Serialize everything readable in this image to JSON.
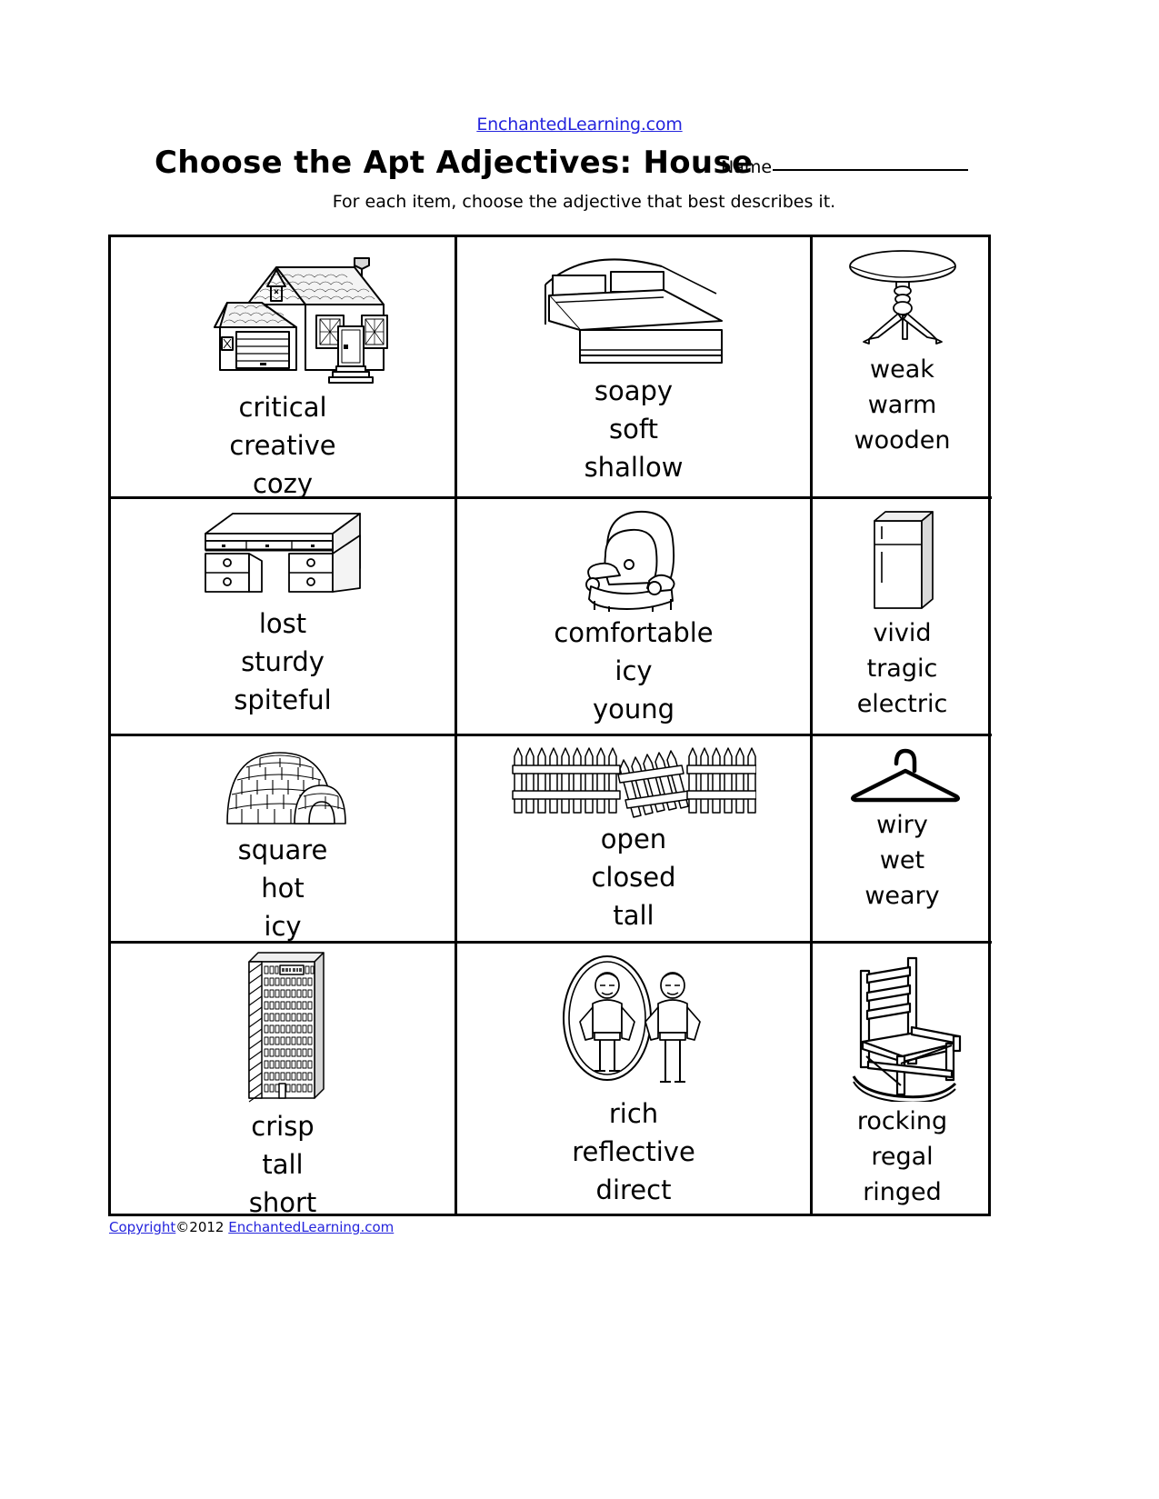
{
  "header": {
    "site_link": "EnchantedLearning.com",
    "title": "Choose the Apt Adjectives: House",
    "subtitle": "For each item, choose the adjective that best describes it.",
    "name_label": "Name"
  },
  "footer": {
    "copyright_link": "Copyright",
    "copyright_text": "©2012 ",
    "site_link": "EnchantedLearning.com"
  },
  "colors": {
    "link": "#2424dd",
    "ink": "#000000",
    "paper": "#ffffff"
  },
  "grid": {
    "columns": 3,
    "rows": 4,
    "cells": [
      {
        "icon": "house-icon",
        "subject": "house",
        "choices": [
          "critical",
          "creative",
          "cozy"
        ]
      },
      {
        "icon": "bed-icon",
        "subject": "bed",
        "choices": [
          "soapy",
          "soft",
          "shallow"
        ]
      },
      {
        "icon": "table-icon",
        "subject": "table",
        "choices": [
          "weak",
          "warm",
          "wooden"
        ]
      },
      {
        "icon": "desk-icon",
        "subject": "desk",
        "choices": [
          "lost",
          "sturdy",
          "spiteful"
        ]
      },
      {
        "icon": "armchair-icon",
        "subject": "armchair",
        "choices": [
          "comfortable",
          "icy",
          "young"
        ]
      },
      {
        "icon": "refrigerator-icon",
        "subject": "refrigerator",
        "choices": [
          "vivid",
          "tragic",
          "electric"
        ]
      },
      {
        "icon": "igloo-icon",
        "subject": "igloo",
        "choices": [
          "square",
          "hot",
          "icy"
        ]
      },
      {
        "icon": "fence-gate-icon",
        "subject": "fence with open gate",
        "choices": [
          "open",
          "closed",
          "tall"
        ]
      },
      {
        "icon": "hanger-icon",
        "subject": "clothes hanger",
        "choices": [
          "wiry",
          "wet",
          "weary"
        ]
      },
      {
        "icon": "apartment-building-icon",
        "subject": "apartment building",
        "choices": [
          "crisp",
          "tall",
          "short"
        ]
      },
      {
        "icon": "mirror-icon",
        "subject": "mirror with reflection",
        "choices": [
          "rich",
          "reflective",
          "direct"
        ]
      },
      {
        "icon": "rocking-chair-icon",
        "subject": "rocking chair",
        "choices": [
          "rocking",
          "regal",
          "ringed"
        ]
      }
    ]
  }
}
